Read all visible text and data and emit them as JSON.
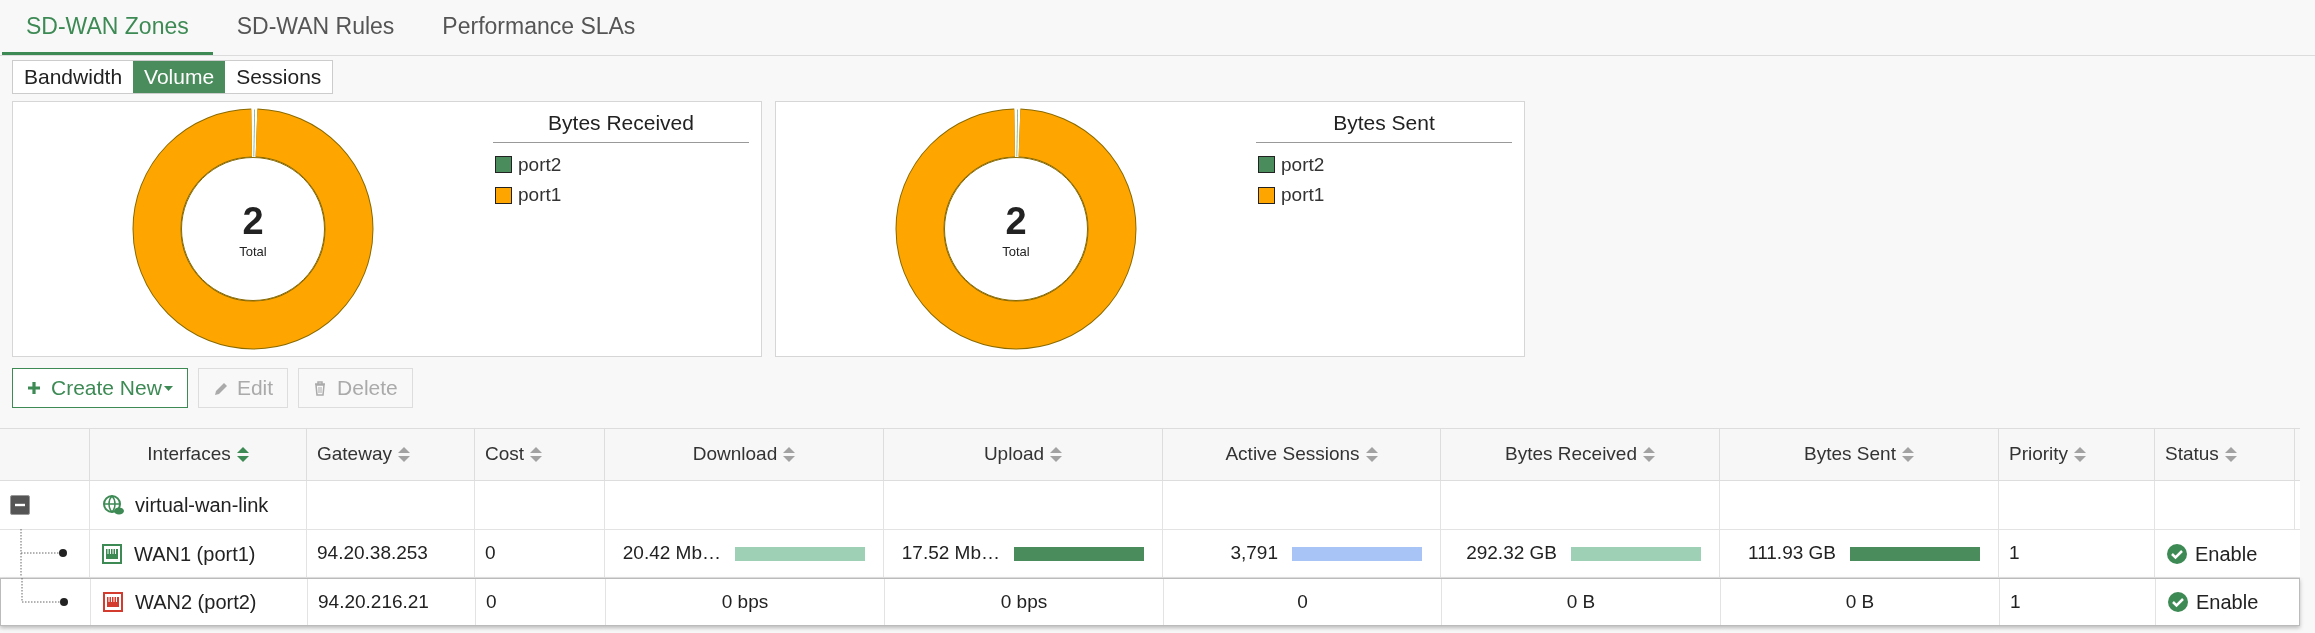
{
  "tabs": [
    {
      "label": "SD-WAN Zones",
      "selected": true
    },
    {
      "label": "SD-WAN Rules",
      "selected": false
    },
    {
      "label": "Performance SLAs",
      "selected": false
    }
  ],
  "view_toggle": [
    {
      "label": "Bandwidth",
      "selected": false
    },
    {
      "label": "Volume",
      "selected": true
    },
    {
      "label": "Sessions",
      "selected": false
    }
  ],
  "charts": [
    {
      "title": "Bytes Received",
      "total": "2",
      "total_label": "Total",
      "legend": [
        {
          "label": "port2",
          "color": "#4a8c5c"
        },
        {
          "label": "port1",
          "color": "#ffa500"
        }
      ]
    },
    {
      "title": "Bytes Sent",
      "total": "2",
      "total_label": "Total",
      "legend": [
        {
          "label": "port2",
          "color": "#4a8c5c"
        },
        {
          "label": "port1",
          "color": "#ffa500"
        }
      ]
    }
  ],
  "toolbar": [
    {
      "kind": "create",
      "label": "Create New",
      "disabled": false
    },
    {
      "kind": "edit",
      "label": "Edit",
      "disabled": true
    },
    {
      "kind": "delete",
      "label": "Delete",
      "disabled": true
    }
  ],
  "table": {
    "columns": [
      {
        "label": "Interfaces",
        "sort_active": true
      },
      {
        "label": "Gateway",
        "sort_active": false
      },
      {
        "label": "Cost",
        "sort_active": false
      },
      {
        "label": "Download",
        "sort_active": false
      },
      {
        "label": "Upload",
        "sort_active": false
      },
      {
        "label": "Active Sessions",
        "sort_active": false
      },
      {
        "label": "Bytes Received",
        "sort_active": false
      },
      {
        "label": "Bytes Sent",
        "sort_active": false
      },
      {
        "label": "Priority",
        "sort_active": false
      },
      {
        "label": "Status",
        "sort_active": false
      }
    ],
    "rows": [
      {
        "kind": "zone",
        "interface": "virtual-wan-link",
        "expanded": true,
        "children": [
          {
            "kind": "member",
            "interface": "WAN1 (port1)",
            "link_up": true,
            "selected": false,
            "gateway": "94.20.38.253",
            "cost": "0",
            "download": {
              "text": "20.42 Mb…",
              "level": 1,
              "color": "#9dd0b4"
            },
            "upload": {
              "text": "17.52 Mb…",
              "level": 1,
              "color": "#4a8c5c"
            },
            "active_sessions": {
              "text": "3,791",
              "level": 1,
              "color": "#a8c3f5"
            },
            "bytes_received": {
              "text": "292.32 GB",
              "level": 1,
              "color": "#9dd0b4"
            },
            "bytes_sent": {
              "text": "111.93 GB",
              "level": 1,
              "color": "#4a8c5c"
            },
            "priority": "1",
            "status": {
              "text": "Enable",
              "enabled": true
            }
          },
          {
            "kind": "member",
            "interface": "WAN2 (port2)",
            "link_up": false,
            "selected": true,
            "gateway": "94.20.216.21",
            "cost": "0",
            "download": {
              "text": "0 bps"
            },
            "upload": {
              "text": "0 bps"
            },
            "active_sessions": {
              "text": "0"
            },
            "bytes_received": {
              "text": "0 B"
            },
            "bytes_sent": {
              "text": "0 B"
            },
            "priority": "1",
            "status": {
              "text": "Enable",
              "enabled": true
            }
          }
        ]
      }
    ]
  }
}
